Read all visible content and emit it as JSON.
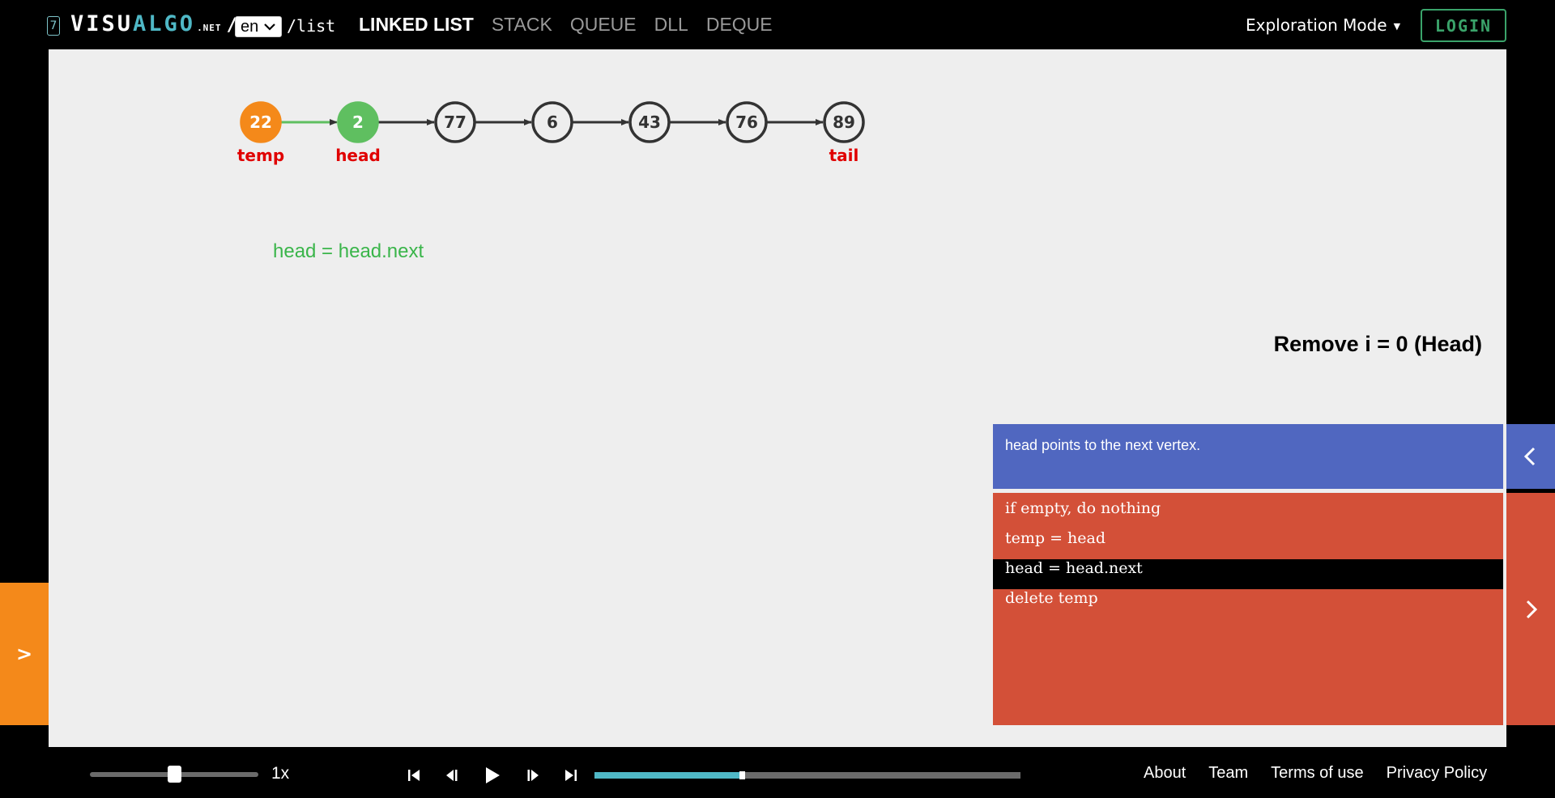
{
  "header": {
    "version_badge": "7",
    "logo": {
      "part1": "VISU",
      "part2": "ALGO",
      "suffix": ".NET",
      "separator": "/"
    },
    "language": {
      "selected": "en"
    },
    "path": "/list",
    "nav_items": [
      {
        "label": "LINKED LIST",
        "active": true
      },
      {
        "label": "STACK",
        "active": false
      },
      {
        "label": "QUEUE",
        "active": false
      },
      {
        "label": "DLL",
        "active": false
      },
      {
        "label": "DEQUE",
        "active": false
      }
    ],
    "mode": "Exploration Mode",
    "login": "LOGIN"
  },
  "visualization": {
    "nodes": [
      {
        "value": "22",
        "label": "temp",
        "state": "temp"
      },
      {
        "value": "2",
        "label": "head",
        "state": "head"
      },
      {
        "value": "77",
        "label": "",
        "state": "normal"
      },
      {
        "value": "6",
        "label": "",
        "state": "normal"
      },
      {
        "value": "43",
        "label": "",
        "state": "normal"
      },
      {
        "value": "76",
        "label": "",
        "state": "normal"
      },
      {
        "value": "89",
        "label": "tail",
        "state": "normal"
      }
    ],
    "caption": "head = head.next",
    "colors": {
      "temp": "#f4891a",
      "head": "#5fbf60",
      "label": "#e00000",
      "edge": "#333333",
      "highlight_edge": "#5fbf60"
    }
  },
  "operation": {
    "title": "Remove i = 0 (Head)",
    "status": "head points to the next vertex.",
    "code_lines": [
      {
        "text": "if empty, do nothing",
        "highlight": false
      },
      {
        "text": "temp = head",
        "highlight": false
      },
      {
        "text": "head = head.next",
        "highlight": true
      },
      {
        "text": "delete temp",
        "highlight": false
      }
    ]
  },
  "side_tab": {
    "label": ">"
  },
  "controls": {
    "speed_label": "1x",
    "speed_fraction": 0.5,
    "progress_fraction": 0.34
  },
  "footer": {
    "links": [
      "About",
      "Team",
      "Terms of use",
      "Privacy Policy"
    ]
  }
}
